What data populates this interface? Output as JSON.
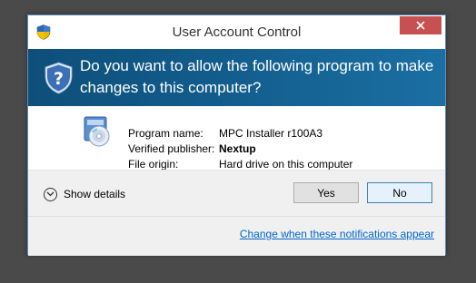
{
  "window": {
    "title": "User Account Control"
  },
  "banner": {
    "question": "Do you want to allow the following program to make changes to this computer?"
  },
  "details": {
    "program_name_label": "Program name:",
    "program_name_value": "MPC Installer r100A3",
    "publisher_label": "Verified publisher:",
    "publisher_value": "Nextup",
    "origin_label": "File origin:",
    "origin_value": "Hard drive on this computer"
  },
  "actions": {
    "show_details_label": "Show details",
    "yes_label": "Yes",
    "no_label": "No"
  },
  "footer": {
    "link_text": "Change when these notifications appear"
  },
  "icons": {
    "title_icon": "uac-shield-icon",
    "banner_icon": "uac-shield-icon",
    "program_icon": "installer-icon",
    "close_icon": "close-icon",
    "expand_icon": "chevron-down-icon"
  },
  "colors": {
    "banner_bg": "#125c8c",
    "close_bg": "#c75050",
    "link": "#0066cc",
    "default_button_border": "#3c7fb1"
  }
}
